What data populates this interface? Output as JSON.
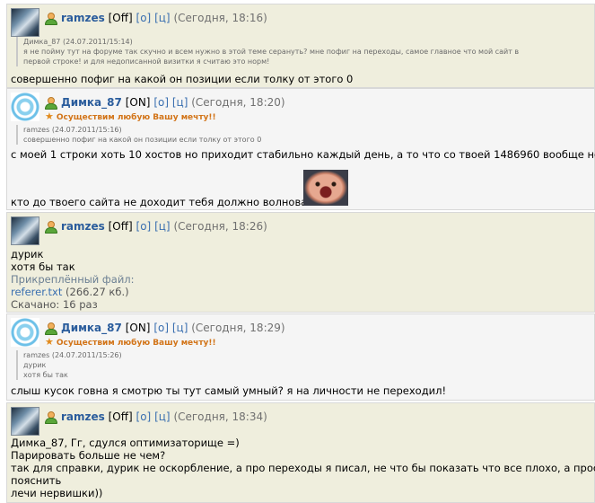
{
  "posts": [
    {
      "author": "ramzes",
      "state": "[Off]",
      "o": "[о]",
      "c": "[ц]",
      "time": "(Сегодня, 18:16)",
      "quote": [
        "Димка_87 (24.07.2011/15:14)",
        "я не пойму тут на форуме так скучно и всем нужно в этой теме серануть? мне пофиг на переходы, самое главное что мой сайт в",
        "первой строке! и для недописанной визитки я считаю это норм!"
      ],
      "message": [
        "совершенно пофиг на какой он позиции если толку от этого 0"
      ]
    },
    {
      "author": "Димка_87",
      "state": "[ON]",
      "o": "[о]",
      "c": "[ц]",
      "time": "(Сегодня, 18:20)",
      "status": "Осуществим любую Вашу мечту!!",
      "quote": [
        "ramzes (24.07.2011/15:16)",
        "совершенно пофиг на какой он позиции если толку от этого 0"
      ],
      "message": [
        "с моей 1 строки хоть 10 хостов но приходит стабильно каждый день, а то что со твоей 1486960 вообще не",
        "кто до твоего сайта не доходит тебя должно волновать"
      ]
    },
    {
      "author": "ramzes",
      "state": "[Off]",
      "o": "[о]",
      "c": "[ц]",
      "time": "(Сегодня, 18:26)",
      "message": [
        "дурик",
        "хотя бы так"
      ],
      "attachment": {
        "label": "Прикреплённый файл:",
        "name": "referer.txt",
        "size": "(266.27 кб.)",
        "downloads": "Скачано: 16 раз"
      }
    },
    {
      "author": "Димка_87",
      "state": "[ON]",
      "o": "[о]",
      "c": "[ц]",
      "time": "(Сегодня, 18:29)",
      "status": "Осуществим любую Вашу мечту!!",
      "quote": [
        "ramzes (24.07.2011/15:26)",
        "дурик",
        "хотя бы так"
      ],
      "message": [
        "слыш кусок говна я смотрю ты тут самый умный? я на личности не переходил!"
      ]
    },
    {
      "author": "ramzes",
      "state": "[Off]",
      "o": "[о]",
      "c": "[ц]",
      "time": "(Сегодня, 18:34)",
      "message": [
        "Димка_87, Гг, сдулся оптимизаторище =)",
        "Парировать больше не чем?",
        "так для справки, дурик не оскорбление, а про переходы я писал, не что бы показать что все плохо, а просто",
        "пояснить",
        "лечи нервишки))"
      ]
    }
  ]
}
